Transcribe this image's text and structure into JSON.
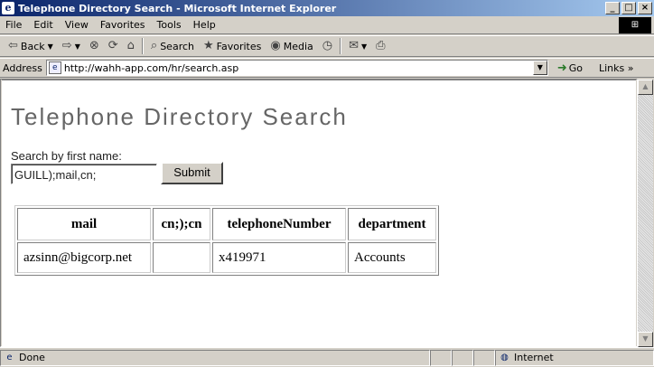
{
  "window": {
    "title": "Telephone Directory Search - Microsoft Internet Explorer",
    "minimize": "_",
    "maximize": "□",
    "close": "×"
  },
  "menu": [
    "File",
    "Edit",
    "View",
    "Favorites",
    "Tools",
    "Help"
  ],
  "toolbar": {
    "back": "Back",
    "forward": "",
    "search": "Search",
    "favorites": "Favorites",
    "media": "Media"
  },
  "address": {
    "label": "Address",
    "url": "http://wahh-app.com/hr/search.asp",
    "go": "Go",
    "links": "Links »"
  },
  "page": {
    "title": "Telephone Directory Search",
    "search_label": "Search by first name:",
    "search_value": "GUILL);mail,cn;",
    "submit": "Submit"
  },
  "results": {
    "headers": [
      "mail",
      "cn;);cn",
      "telephoneNumber",
      "department"
    ],
    "rows": [
      [
        "azsinn@bigcorp.net",
        "",
        "x419971",
        "Accounts"
      ]
    ]
  },
  "status": {
    "text": "Done",
    "zone": "Internet"
  }
}
